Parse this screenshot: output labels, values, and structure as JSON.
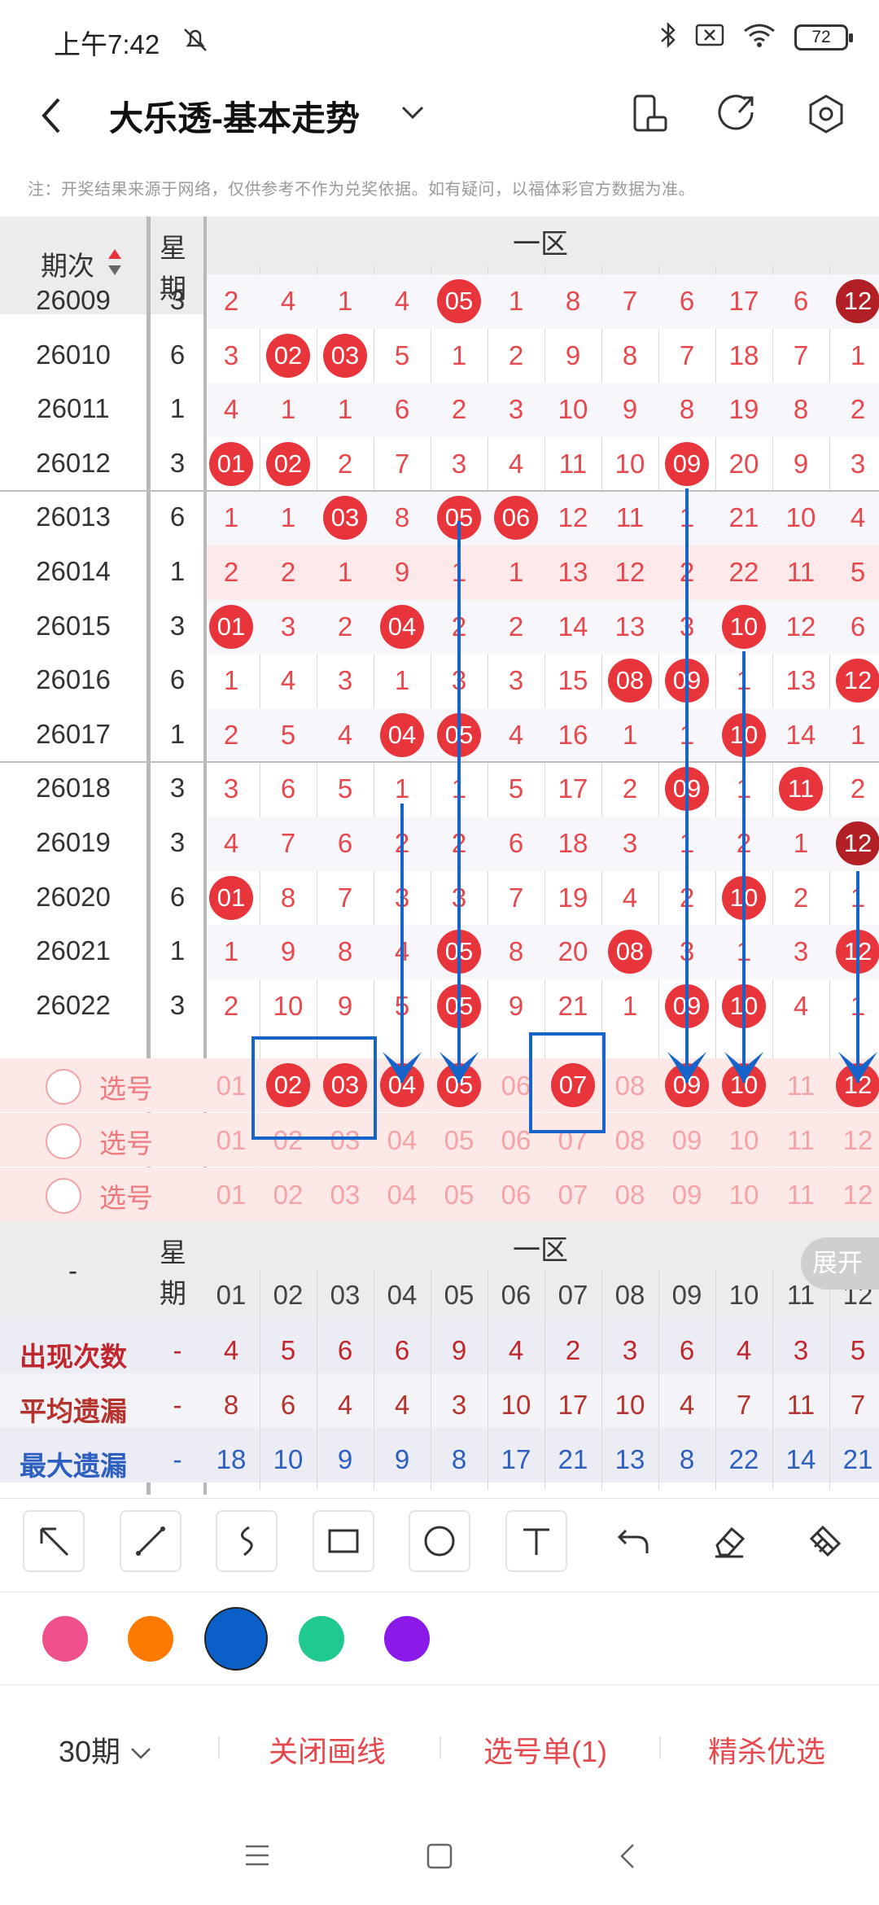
{
  "status": {
    "time": "上午7:42",
    "battery": "72"
  },
  "header": {
    "title": "大乐透-基本走势"
  },
  "note": "注：开奖结果来源于网络，仅供参考不作为兑奖依据。如有疑问，以福体彩官方数据为准。",
  "table": {
    "col_period": "期次",
    "col_week": "星期",
    "zone": "一区",
    "numbers": [
      "01",
      "02",
      "03",
      "04",
      "05",
      "06",
      "07",
      "08",
      "09",
      "10",
      "11",
      "12"
    ],
    "rows": [
      {
        "period": "26009",
        "week": "3",
        "cells": [
          "2",
          "4",
          "1",
          "4",
          "05",
          "1",
          "8",
          "7",
          "6",
          "17",
          "6",
          "12"
        ],
        "hits": [
          4,
          11
        ],
        "dark": [
          11
        ]
      },
      {
        "period": "26010",
        "week": "6",
        "cells": [
          "3",
          "02",
          "03",
          "5",
          "1",
          "2",
          "9",
          "8",
          "7",
          "18",
          "7",
          "1"
        ],
        "hits": [
          1,
          2
        ],
        "dark": []
      },
      {
        "period": "26011",
        "week": "1",
        "cells": [
          "4",
          "1",
          "1",
          "6",
          "2",
          "3",
          "10",
          "9",
          "8",
          "19",
          "8",
          "2"
        ],
        "hits": [],
        "dark": []
      },
      {
        "period": "26012",
        "week": "3",
        "cells": [
          "01",
          "02",
          "2",
          "7",
          "3",
          "4",
          "11",
          "10",
          "09",
          "20",
          "9",
          "3"
        ],
        "hits": [
          0,
          1,
          8
        ],
        "dark": []
      },
      {
        "period": "26013",
        "week": "6",
        "cells": [
          "1",
          "1",
          "03",
          "8",
          "05",
          "06",
          "12",
          "11",
          "1",
          "21",
          "10",
          "4"
        ],
        "hits": [
          2,
          4,
          5
        ],
        "dark": []
      },
      {
        "period": "26014",
        "week": "1",
        "cells": [
          "2",
          "2",
          "1",
          "9",
          "1",
          "1",
          "13",
          "12",
          "2",
          "22",
          "11",
          "5"
        ],
        "hits": [],
        "dark": []
      },
      {
        "period": "26015",
        "week": "3",
        "cells": [
          "01",
          "3",
          "2",
          "04",
          "2",
          "2",
          "14",
          "13",
          "3",
          "10",
          "12",
          "6"
        ],
        "hits": [
          0,
          3,
          9
        ],
        "dark": []
      },
      {
        "period": "26016",
        "week": "6",
        "cells": [
          "1",
          "4",
          "3",
          "1",
          "3",
          "3",
          "15",
          "08",
          "09",
          "1",
          "13",
          "12"
        ],
        "hits": [
          7,
          8,
          11
        ],
        "dark": []
      },
      {
        "period": "26017",
        "week": "1",
        "cells": [
          "2",
          "5",
          "4",
          "04",
          "05",
          "4",
          "16",
          "1",
          "1",
          "10",
          "14",
          "1"
        ],
        "hits": [
          3,
          4,
          9
        ],
        "dark": []
      },
      {
        "period": "26018",
        "week": "3",
        "cells": [
          "3",
          "6",
          "5",
          "1",
          "1",
          "5",
          "17",
          "2",
          "09",
          "1",
          "11",
          "2"
        ],
        "hits": [
          8,
          10
        ],
        "dark": []
      },
      {
        "period": "26019",
        "week": "3",
        "cells": [
          "4",
          "7",
          "6",
          "2",
          "2",
          "6",
          "18",
          "3",
          "1",
          "2",
          "1",
          "12"
        ],
        "hits": [
          11
        ],
        "dark": [
          11
        ]
      },
      {
        "period": "26020",
        "week": "6",
        "cells": [
          "01",
          "8",
          "7",
          "3",
          "3",
          "7",
          "19",
          "4",
          "2",
          "10",
          "2",
          "1"
        ],
        "hits": [
          0,
          9
        ],
        "dark": []
      },
      {
        "period": "26021",
        "week": "1",
        "cells": [
          "1",
          "9",
          "8",
          "4",
          "05",
          "8",
          "20",
          "08",
          "3",
          "1",
          "3",
          "12"
        ],
        "hits": [
          4,
          7,
          11
        ],
        "dark": []
      },
      {
        "period": "26022",
        "week": "3",
        "cells": [
          "2",
          "10",
          "9",
          "5",
          "05",
          "9",
          "21",
          "1",
          "09",
          "10",
          "4",
          "1"
        ],
        "hits": [
          4,
          8,
          9
        ],
        "dark": []
      }
    ],
    "select_label": "选号",
    "selected": [
      1,
      2,
      3,
      4,
      6,
      8,
      9,
      11
    ]
  },
  "stats": {
    "dash": "-",
    "zone": "一区",
    "week": "星期",
    "rows": [
      {
        "label": "出现次数",
        "mark": "-",
        "color": "#c0262d",
        "values": [
          "4",
          "5",
          "6",
          "6",
          "9",
          "4",
          "2",
          "3",
          "6",
          "4",
          "3",
          "5"
        ]
      },
      {
        "label": "平均遗漏",
        "mark": "-",
        "color": "#b5332d",
        "values": [
          "8",
          "6",
          "4",
          "4",
          "3",
          "10",
          "17",
          "10",
          "4",
          "7",
          "11",
          "7"
        ]
      },
      {
        "label": "最大遗漏",
        "mark": "-",
        "color": "#2c5fbf",
        "values": [
          "18",
          "10",
          "9",
          "9",
          "8",
          "17",
          "21",
          "13",
          "8",
          "22",
          "14",
          "21"
        ]
      }
    ],
    "expand": "展开"
  },
  "tools": [
    "arrow-tool",
    "line-tool",
    "curve-tool",
    "rectangle-tool",
    "circle-tool",
    "text-tool",
    "undo-tool",
    "eraser-tool",
    "clear-tool"
  ],
  "palette": [
    "#ef4f8a",
    "#ff7a00",
    "#0a5fc9",
    "#1fc98f",
    "#8b19e8"
  ],
  "bottom": {
    "periods": "30期",
    "close_draw": "关闭画线",
    "pick_list": "选号单(1)",
    "kill": "精杀优选"
  }
}
